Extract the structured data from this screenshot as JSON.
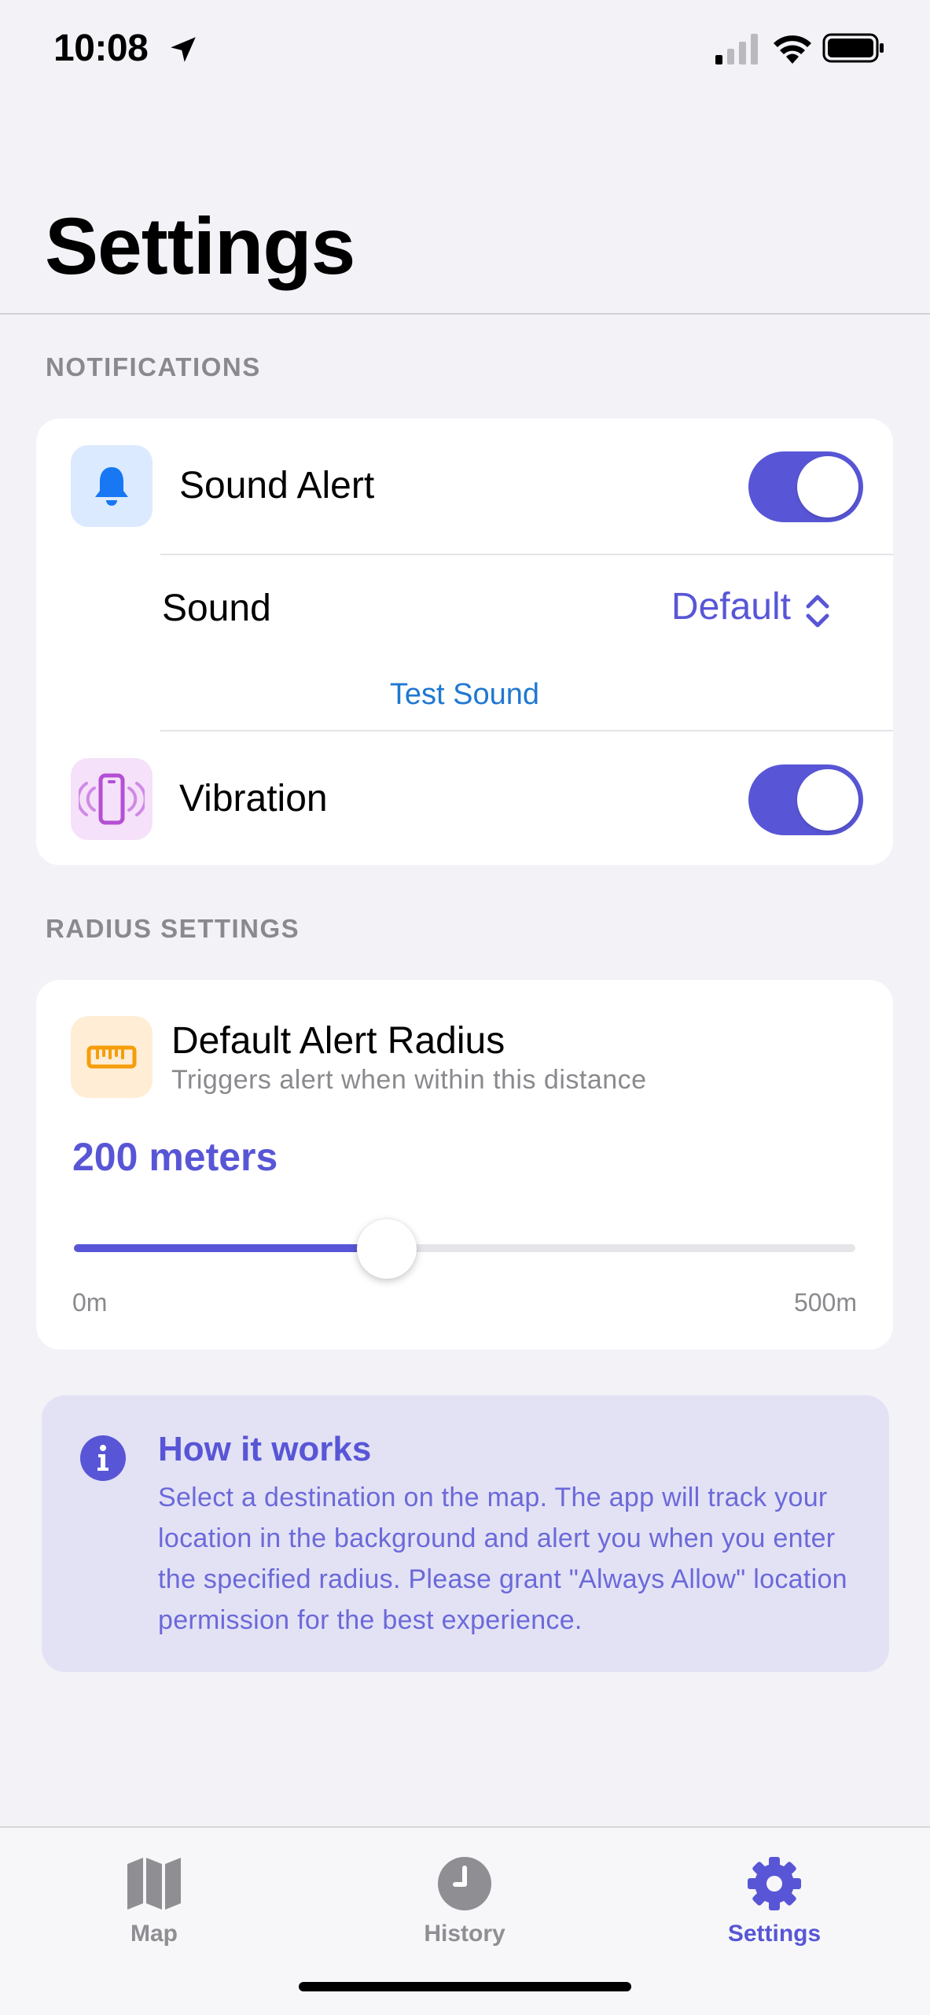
{
  "status_bar": {
    "time": "10:08",
    "icons": [
      "location-arrow-icon",
      "cellular-signal-icon",
      "wifi-icon",
      "battery-icon"
    ]
  },
  "page": {
    "title": "Settings"
  },
  "notifications": {
    "header": "NOTIFICATIONS",
    "sound_alert": {
      "label": "Sound Alert",
      "icon": "bell-icon",
      "enabled": true
    },
    "sound": {
      "label": "Sound",
      "value": "Default"
    },
    "test_sound_label": "Test Sound",
    "vibration": {
      "label": "Vibration",
      "icon": "phone-vibrate-icon",
      "enabled": true
    }
  },
  "radius": {
    "header": "RADIUS SETTINGS",
    "title": "Default Alert Radius",
    "subtitle": "Triggers alert when within this distance",
    "icon": "ruler-icon",
    "value_label": "200 meters",
    "value": 200,
    "min": 0,
    "max": 500,
    "min_label": "0m",
    "max_label": "500m"
  },
  "info": {
    "title": "How it works",
    "body": "Select a destination on the map. The app will track your location in the background and alert you when you enter the specified radius. Please grant \"Always Allow\" location permission for the best experience."
  },
  "tab_bar": {
    "items": [
      {
        "label": "Map",
        "icon": "map-icon",
        "active": false
      },
      {
        "label": "History",
        "icon": "clock-icon",
        "active": false
      },
      {
        "label": "Settings",
        "icon": "gear-icon",
        "active": true
      }
    ]
  },
  "colors": {
    "accent": "#5856d6",
    "link": "#1f78d1",
    "background": "#f2f2f7",
    "info_background": "#e3e2f5"
  }
}
